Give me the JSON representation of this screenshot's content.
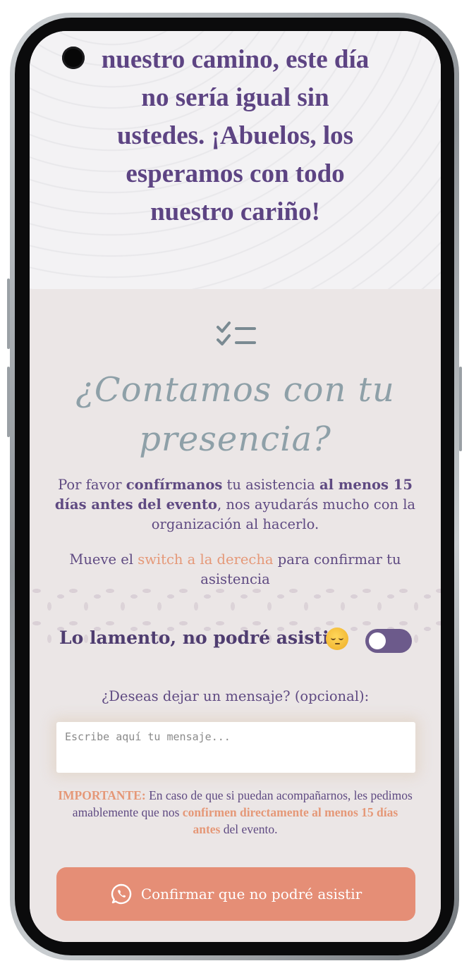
{
  "hero": {
    "lines": [
      "nuestro camino, este día",
      "no sería igual sin",
      "ustedes. ¡Abuelos, los",
      "esperamos con todo",
      "nuestro cariño!"
    ]
  },
  "rsvp": {
    "title_line1": "¿Contamos con tu",
    "title_line2": "presencia?",
    "intro": {
      "t1": "Por favor ",
      "b1": "confírmanos",
      "t2": " tu asistencia ",
      "b2": "al menos 15 días antes del evento",
      "t3": ", nos ayudarás mucho con la organización al hacerlo."
    },
    "switch_hint": {
      "t1": "Mueve el ",
      "accent": "switch a la derecha",
      "t2": " para confirmar tu asistencia"
    },
    "toggle_label": "Lo lamento, no podré asistir",
    "toggle_state": "off",
    "message_label": "¿Deseas dejar un mensaje? (opcional):",
    "message_placeholder": "Escribe aquí tu mensaje...",
    "important": {
      "label": "IMPORTANTE:",
      "t1": " En caso de que si puedan acompañarnos, les pedimos amablemente que nos ",
      "accent": "confirmen directamente al menos 15 días antes",
      "t2": " del evento."
    },
    "confirm_button": "Confirmar que no podré asistir"
  },
  "colors": {
    "primary_text": "#5f4a82",
    "accent": "#e59878",
    "button": "#e58e76",
    "switch": "#6c5a8b",
    "script_title": "#8ea0a8"
  },
  "icons": [
    "check-list-icon",
    "sad-emoji-icon",
    "whatsapp-icon"
  ]
}
